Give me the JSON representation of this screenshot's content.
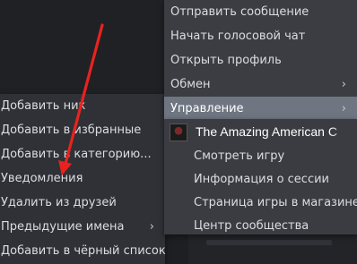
{
  "main_menu": {
    "items": [
      {
        "label": "Отправить сообщение"
      },
      {
        "label": "Начать голосовой чат"
      },
      {
        "label": "Открыть профиль"
      },
      {
        "label": "Обмен",
        "arrow": "›"
      },
      {
        "label": "Управление",
        "arrow": "›"
      }
    ]
  },
  "left_menu": {
    "items": [
      {
        "label": "Добавить ник"
      },
      {
        "label": "Добавить в избранные"
      },
      {
        "label": "Добавить в категорию..."
      },
      {
        "label": "Уведомления"
      },
      {
        "label": "Удалить из друзей"
      },
      {
        "label": "Предыдущие имена",
        "arrow": "›"
      },
      {
        "label": "Добавить в чёрный список"
      }
    ]
  },
  "sub_menu": {
    "game_title": "The Amazing American C",
    "items": [
      {
        "label": "Смотреть игру"
      },
      {
        "label": "Информация о сессии"
      },
      {
        "label": "Страница игры в магазине"
      },
      {
        "label": "Центр сообщества"
      }
    ]
  },
  "annotation": {
    "arrow_color": "#e8231f"
  },
  "colors": {
    "highlight": "#6f7682",
    "menu_bg": "#3b3d42"
  }
}
